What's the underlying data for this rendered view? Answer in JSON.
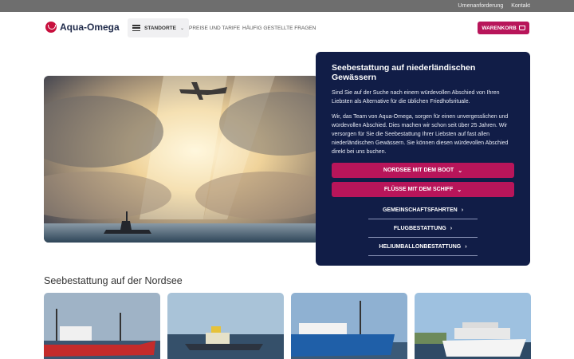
{
  "topbar": {
    "links": [
      "Urnenanforderung",
      "Kontakt"
    ]
  },
  "header": {
    "logo_text": "Aqua-Omega",
    "menu_label": "STANDORTE",
    "nav": [
      "PREISE UND TARIFE",
      "HÄUFIG GESTELLTE FRAGEN"
    ],
    "cart_label": "WARENKORB"
  },
  "panel": {
    "title": "Seebestattung auf niederländischen Gewässern",
    "p1": "Sind Sie auf der Suche nach einem würdevollen Abschied von Ihren Liebsten als Alternative für die üblichen Friedhofsrituale.",
    "p2": "Wir, das Team von Aqua-Omega, sorgen für einen unvergesslichen und würdevollen Abschied. Dies machen wir schon seit über 25 Jahren. Wir versorgen für Sie die Seebestattung Ihrer Liebsten auf fast allen niederländischen Gewässern. Sie können diesen würdevollen Abschied direkt bei uns buchen.",
    "primary_buttons": [
      "NORDSEE MIT DEM BOOT",
      "FLÜSSE MIT DEM SCHIFF"
    ],
    "link_buttons": [
      "GEMEINSCHAFTSFAHRTEN",
      "FLUGBESTATTUNG",
      "HELIUMBALLONBESTATTUNG"
    ]
  },
  "section": {
    "title": "Seebestattung auf der Nordsee"
  },
  "colors": {
    "brand_pink": "#b8155a",
    "navy": "#111d47",
    "logo_red": "#c8103e"
  }
}
